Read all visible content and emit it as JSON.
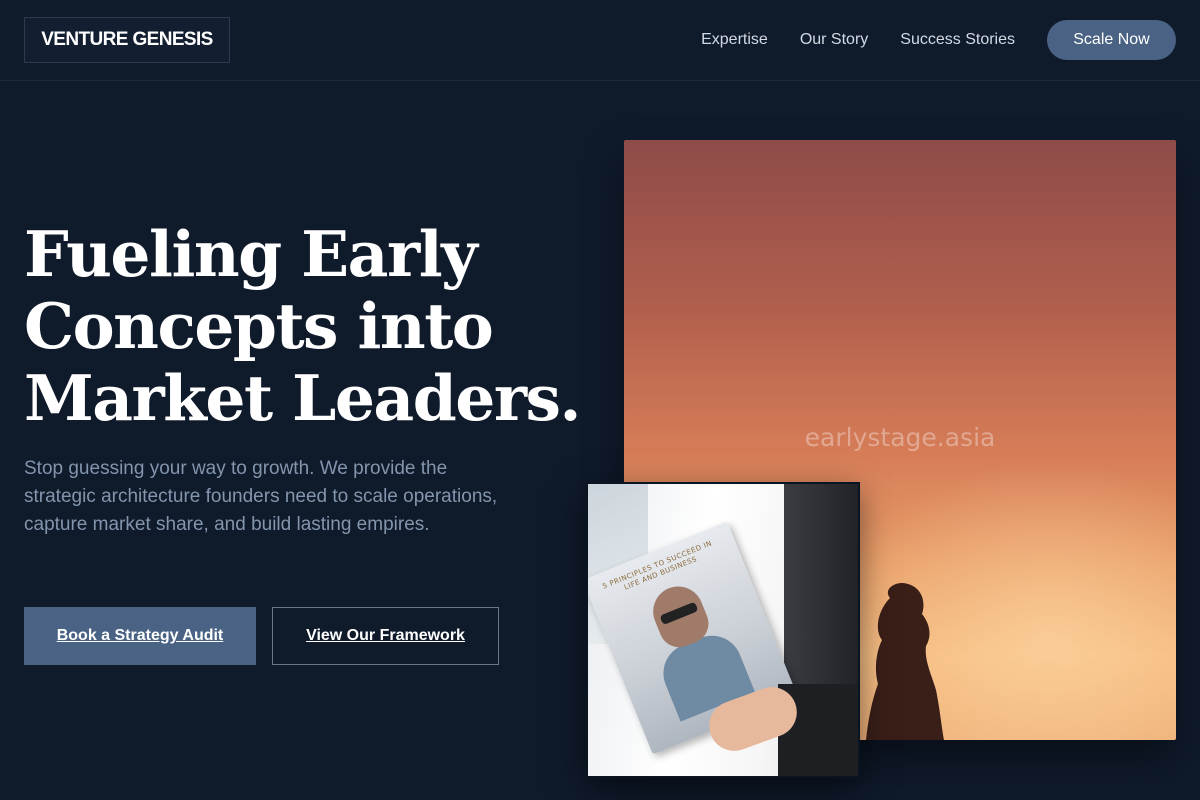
{
  "brand": {
    "logo_text": "VENTURE GENESIS"
  },
  "nav": {
    "items": [
      {
        "label": "Expertise"
      },
      {
        "label": "Our Story"
      },
      {
        "label": "Success Stories"
      }
    ],
    "cta_label": "Scale Now"
  },
  "hero": {
    "headline_lines": [
      "Fueling Early",
      "Concepts into",
      "Market Leaders."
    ],
    "subcopy": "Stop guessing your way to growth. We provide the strategic architecture founders need to scale operations, capture market share, and build lasting empires.",
    "primary_button": "Book a Strategy Audit",
    "secondary_button": "View Our Framework",
    "image_watermark": "earlystage.asia",
    "book_cover_text": "5 PRINCIPLES TO SUCCEED IN LIFE AND BUSINESS"
  },
  "colors": {
    "background": "#0f1a2b",
    "accent": "#4a6384",
    "muted_text": "#8395ad"
  }
}
